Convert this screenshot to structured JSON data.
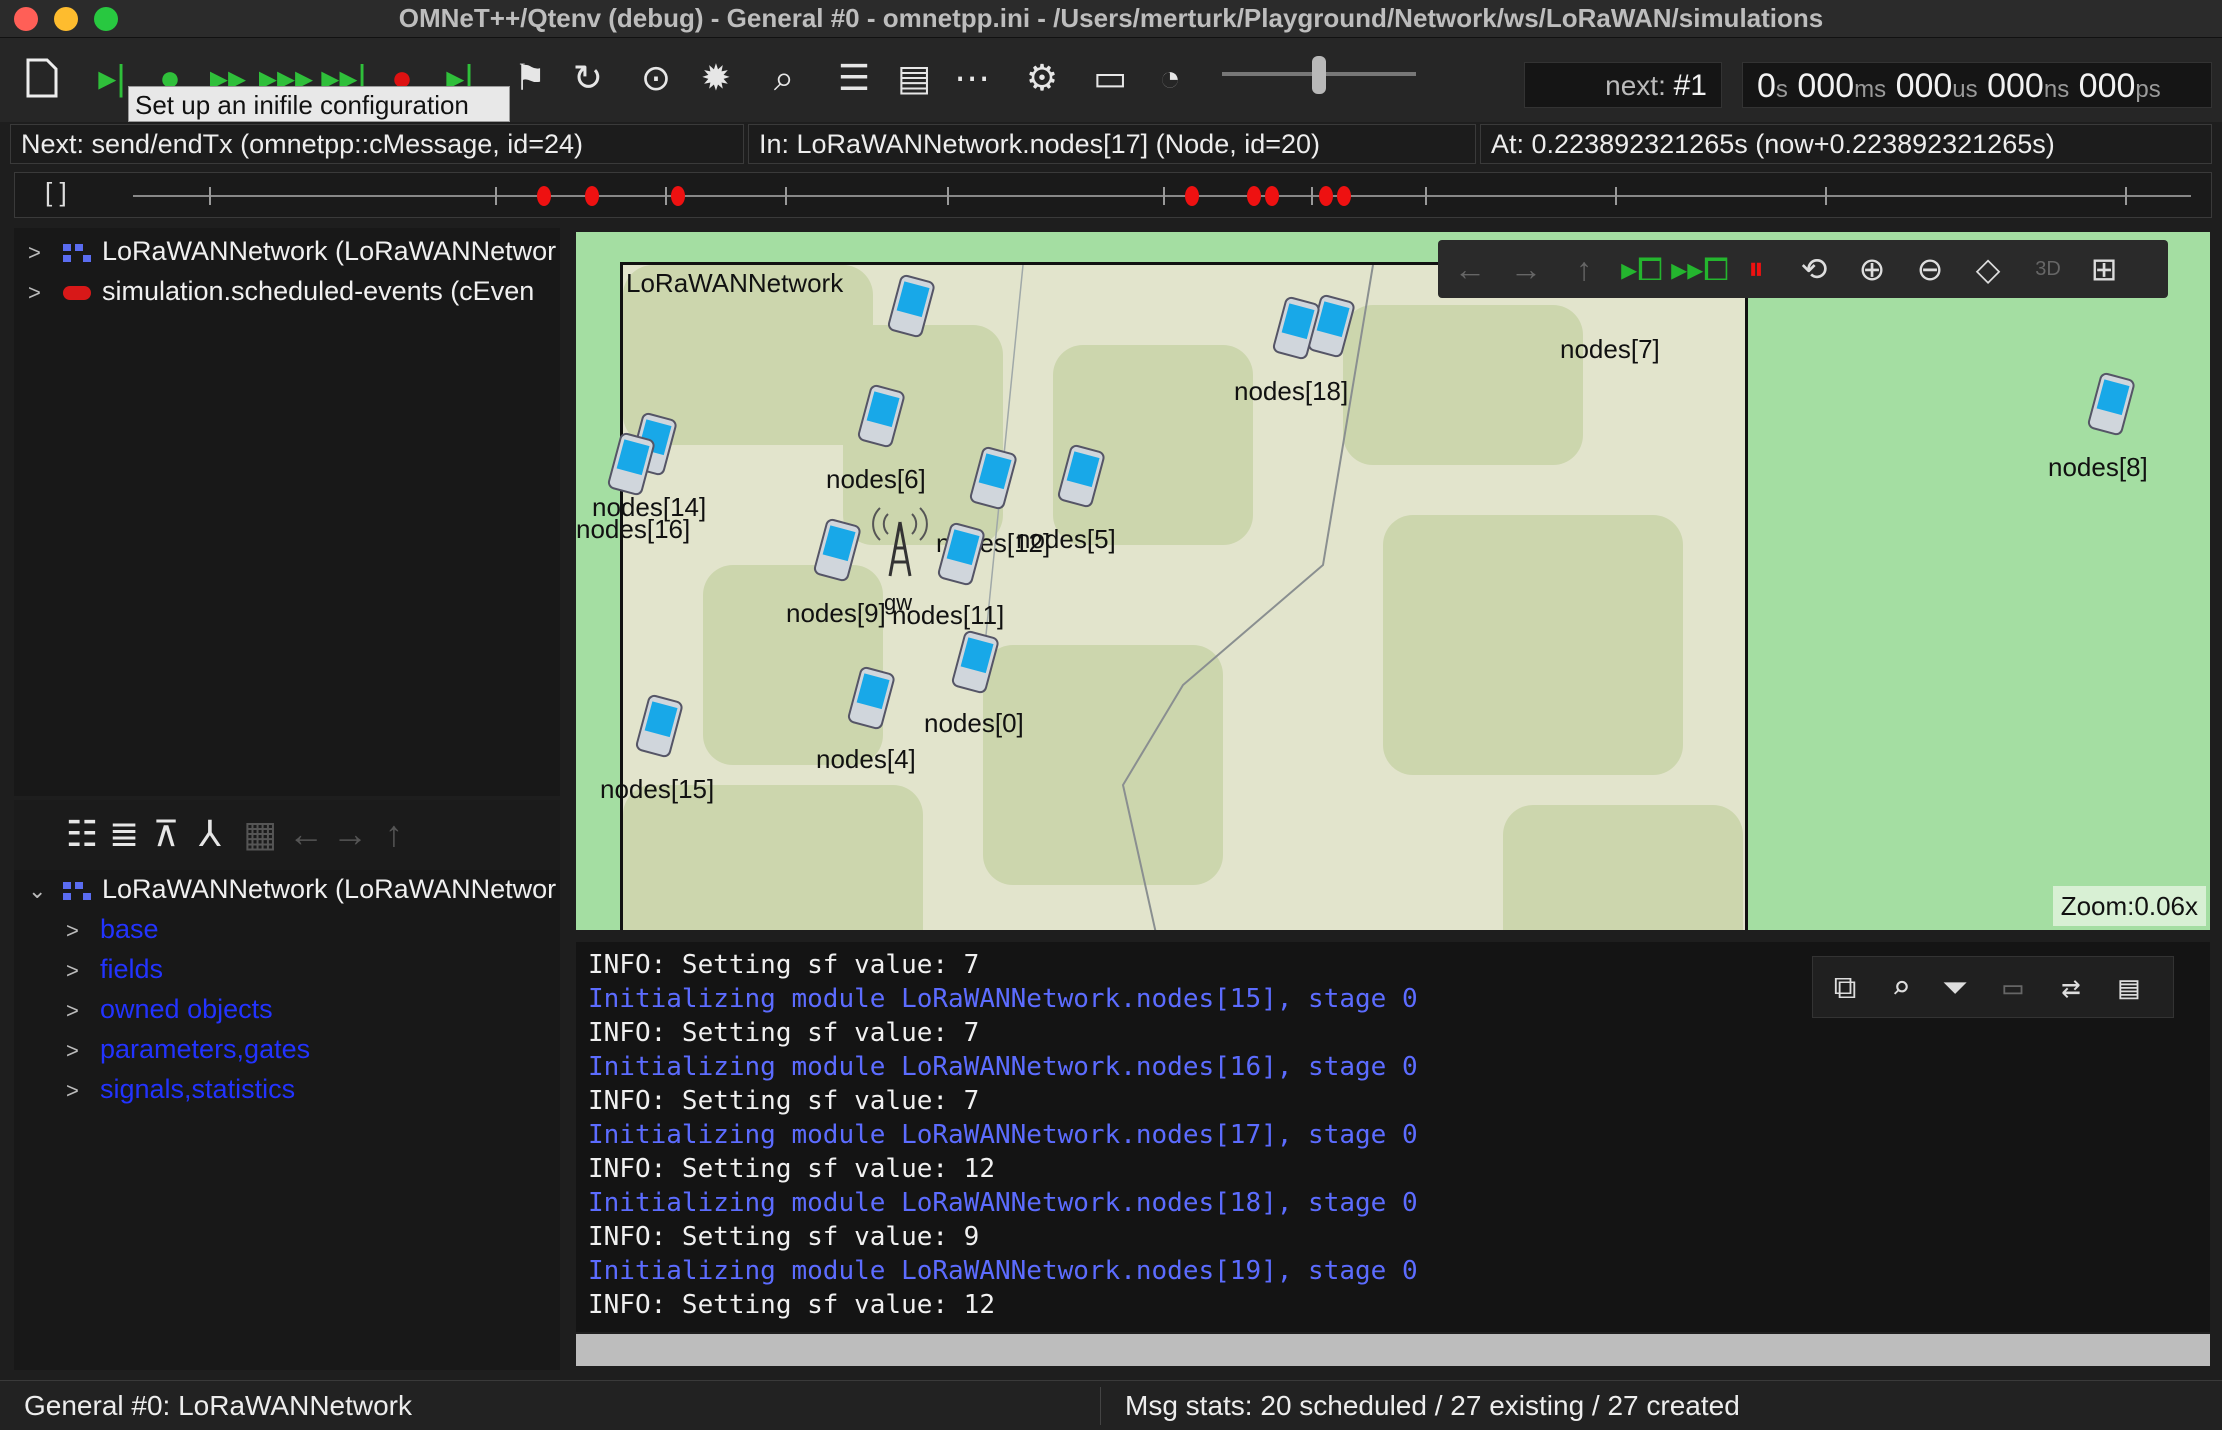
{
  "window": {
    "title": "OMNeT++/Qtenv (debug) - General #0 - omnetpp.ini - /Users/merturk/Playground/Network/ws/LoRaWAN/simulations"
  },
  "toolbar": {
    "tooltip": "Set up an inifile configuration",
    "next_event_prefix": "next: ",
    "next_event": "#1",
    "sim_time": {
      "s": "0",
      "s_unit": "s",
      "ms": "000",
      "ms_unit": "ms",
      "us": "000",
      "us_unit": "us",
      "ns": "000",
      "ns_unit": "ns",
      "ps": "000",
      "ps_unit": "ps"
    }
  },
  "info_bar": {
    "next": "Next: send/endTx (omnetpp::cMessage, id=24)",
    "in": "In: LoRaWANNetwork.nodes[17] (Node, id=20)",
    "at": "At: 0.223892321265s (now+0.223892321265s)"
  },
  "timeline": {
    "brackets": "[   ]"
  },
  "object_tree": [
    {
      "label": "LoRaWANNetwork (LoRaWANNetwor",
      "icon": "network-icon"
    },
    {
      "label": "simulation.scheduled-events (cEven",
      "icon": "event-queue-icon"
    }
  ],
  "inspector": {
    "root": "LoRaWANNetwork (LoRaWANNetwor",
    "groups": [
      "base",
      "fields",
      "owned objects",
      "parameters,gates",
      "signals,statistics"
    ]
  },
  "canvas": {
    "network_name": "LoRaWANNetwork",
    "zoom": "Zoom:0.06x",
    "nodes": [
      {
        "label": "nodes[18]"
      },
      {
        "label": "nodes[7]"
      },
      {
        "label": "nodes[8]"
      },
      {
        "label": "nodes[6]"
      },
      {
        "label": "nodes[14]"
      },
      {
        "label": "nodes[16]"
      },
      {
        "label": "nodes[12]"
      },
      {
        "label": "nodes[5]"
      },
      {
        "label": "nodes[9]"
      },
      {
        "label": "nodes[11]"
      },
      {
        "label": "nodes[0]"
      },
      {
        "label": "nodes[4]"
      },
      {
        "label": "nodes[15]"
      }
    ],
    "gateway_label": "gw"
  },
  "log": [
    {
      "type": "info",
      "text": "INFO: Setting sf value: 7"
    },
    {
      "type": "blue",
      "text": "Initializing module LoRaWANNetwork.nodes[15], stage 0"
    },
    {
      "type": "info",
      "text": "INFO: Setting sf value: 7"
    },
    {
      "type": "blue",
      "text": "Initializing module LoRaWANNetwork.nodes[16], stage 0"
    },
    {
      "type": "info",
      "text": "INFO: Setting sf value: 7"
    },
    {
      "type": "blue",
      "text": "Initializing module LoRaWANNetwork.nodes[17], stage 0"
    },
    {
      "type": "info",
      "text": "INFO: Setting sf value: 12"
    },
    {
      "type": "blue",
      "text": "Initializing module LoRaWANNetwork.nodes[18], stage 0"
    },
    {
      "type": "info",
      "text": "INFO: Setting sf value: 9"
    },
    {
      "type": "blue",
      "text": "Initializing module LoRaWANNetwork.nodes[19], stage 0"
    },
    {
      "type": "info",
      "text": "INFO: Setting sf value: 12"
    }
  ],
  "status_bar": {
    "left": "General #0: LoRaWANNetwork",
    "right": "Msg stats: 20 scheduled / 27 existing / 27 created"
  },
  "colors": {
    "canvas_bg": "#a4dea2",
    "log_blue": "#5c6cff",
    "event_marker": "#e11111",
    "run_green": "#2fbf3a",
    "stop_red": "#d11111"
  }
}
